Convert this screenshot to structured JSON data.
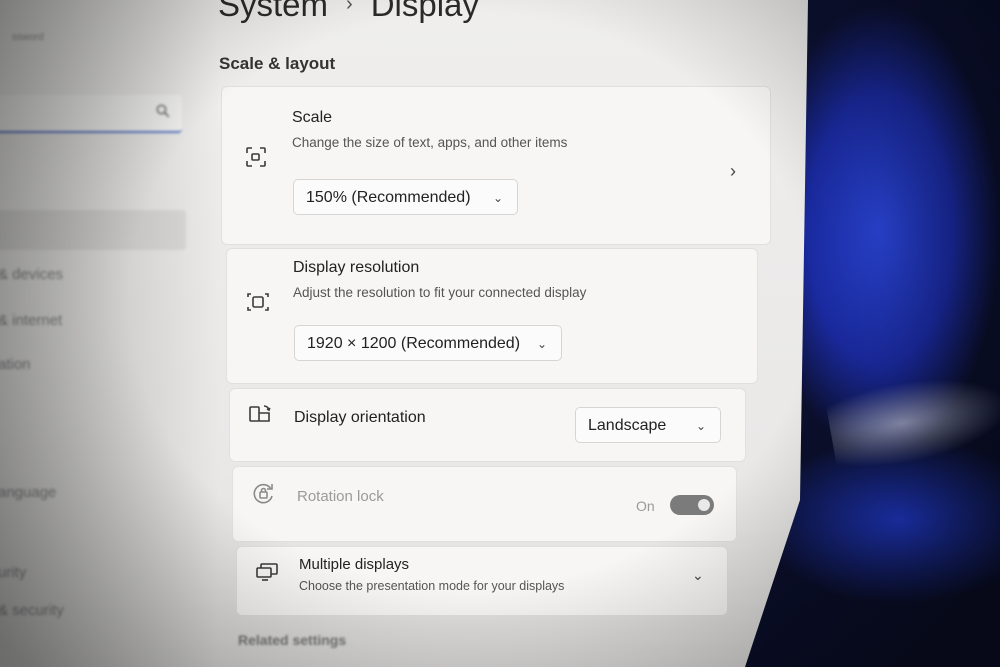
{
  "sidebar": {
    "account_text": "ssword",
    "search": {
      "placeholder": "",
      "icon": "search-icon"
    },
    "items": [
      {
        "label": "& devices"
      },
      {
        "label": "& internet"
      },
      {
        "label": "ation"
      },
      {
        "label": ""
      },
      {
        "label": "anguage"
      },
      {
        "label": "urity"
      },
      {
        "label": "& security"
      }
    ]
  },
  "header": {
    "parent": "System",
    "separator": "›",
    "current": "Display"
  },
  "main": {
    "section_title": "Scale & layout",
    "scale": {
      "title": "Scale",
      "description": "Change the size of text, apps, and other items",
      "value": "150% (Recommended)",
      "icon": "scale-icon"
    },
    "resolution": {
      "title": "Display resolution",
      "description": "Adjust the resolution to fit your connected display",
      "value": "1920 × 1200 (Recommended)",
      "icon": "resolution-icon"
    },
    "orientation": {
      "title": "Display orientation",
      "value": "Landscape",
      "icon": "orientation-icon"
    },
    "rotation_lock": {
      "title": "Rotation lock",
      "state_label": "On",
      "enabled": true,
      "icon": "rotation-lock-icon"
    },
    "multiple_displays": {
      "title": "Multiple displays",
      "description": "Choose the presentation mode for your displays",
      "icon": "multiple-displays-icon"
    },
    "related_title": "Related settings"
  },
  "colors": {
    "accent": "#5b77c4",
    "toggle_on": "#7b7b7b",
    "window_bg": "#efeeed"
  }
}
